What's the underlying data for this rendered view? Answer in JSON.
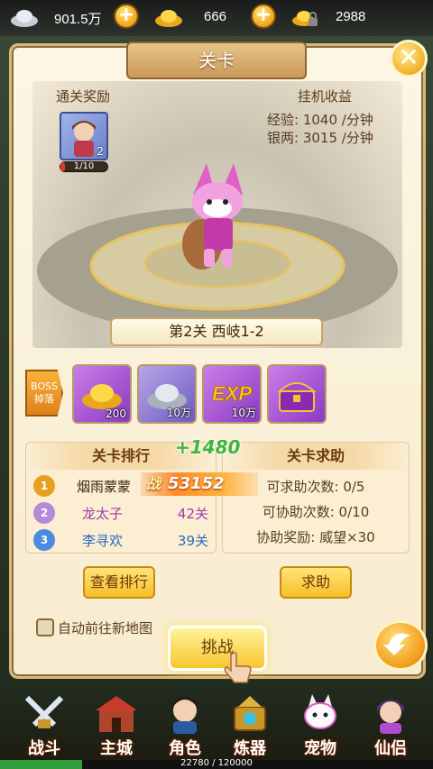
{
  "resources": [
    {
      "name": "silver",
      "icon": "silver-ingot-icon",
      "value": "901.5万"
    },
    {
      "name": "gold",
      "icon": "gold-ingot-icon",
      "value": "666"
    },
    {
      "name": "bound-gold",
      "icon": "locked-gold-icon",
      "value": "2988"
    }
  ],
  "panel": {
    "title": "关卡",
    "rewards_label": "通关奖励",
    "reward_item": {
      "count": "2",
      "fragment_text": "1/10",
      "fragment_progress": 0.1
    },
    "idle_label": "挂机收益",
    "exp_rate": "经验:  1040 /分钟",
    "silver_rate": "银两:  3015 /分钟",
    "stage_name": "第2关 西岐1-2",
    "boss_tag": [
      "BOSS",
      "掉落"
    ],
    "drops": [
      {
        "icon": "gold-ingot-icon",
        "count": "200"
      },
      {
        "icon": "silver-ingot-icon",
        "count": "10万"
      },
      {
        "icon": "exp-icon",
        "count": "10万",
        "text": "EXP"
      },
      {
        "icon": "treasure-chest-icon",
        "count": ""
      }
    ]
  },
  "ranking": {
    "title": "关卡排行",
    "rows": [
      {
        "rank": "1",
        "name": "烟雨蒙蒙",
        "value": ""
      },
      {
        "rank": "2",
        "name": "龙太子",
        "value": "42关"
      },
      {
        "rank": "3",
        "name": "李寻欢",
        "value": "39关"
      }
    ],
    "button": "查看排行"
  },
  "power": {
    "gain": "+1480",
    "value": "53152",
    "label": "战"
  },
  "help": {
    "title": "关卡求助",
    "lines": [
      "可求助次数: 0/5",
      "可协助次数: 0/10",
      "协助奖励: 威望×30"
    ],
    "button": "求助"
  },
  "auto_next": {
    "label": "自动前往新地图",
    "checked": false
  },
  "challenge_button": "挑战",
  "nav": [
    {
      "label": "战斗",
      "icon": "battle-swords-icon"
    },
    {
      "label": "主城",
      "icon": "city-gate-icon"
    },
    {
      "label": "角色",
      "icon": "hero-portrait-icon"
    },
    {
      "label": "炼器",
      "icon": "forge-icon"
    },
    {
      "label": "宠物",
      "icon": "pet-icon"
    },
    {
      "label": "仙侣",
      "icon": "fairy-icon"
    }
  ],
  "exp_bar": {
    "text": "22780 / 120000",
    "progress": 0.19
  }
}
